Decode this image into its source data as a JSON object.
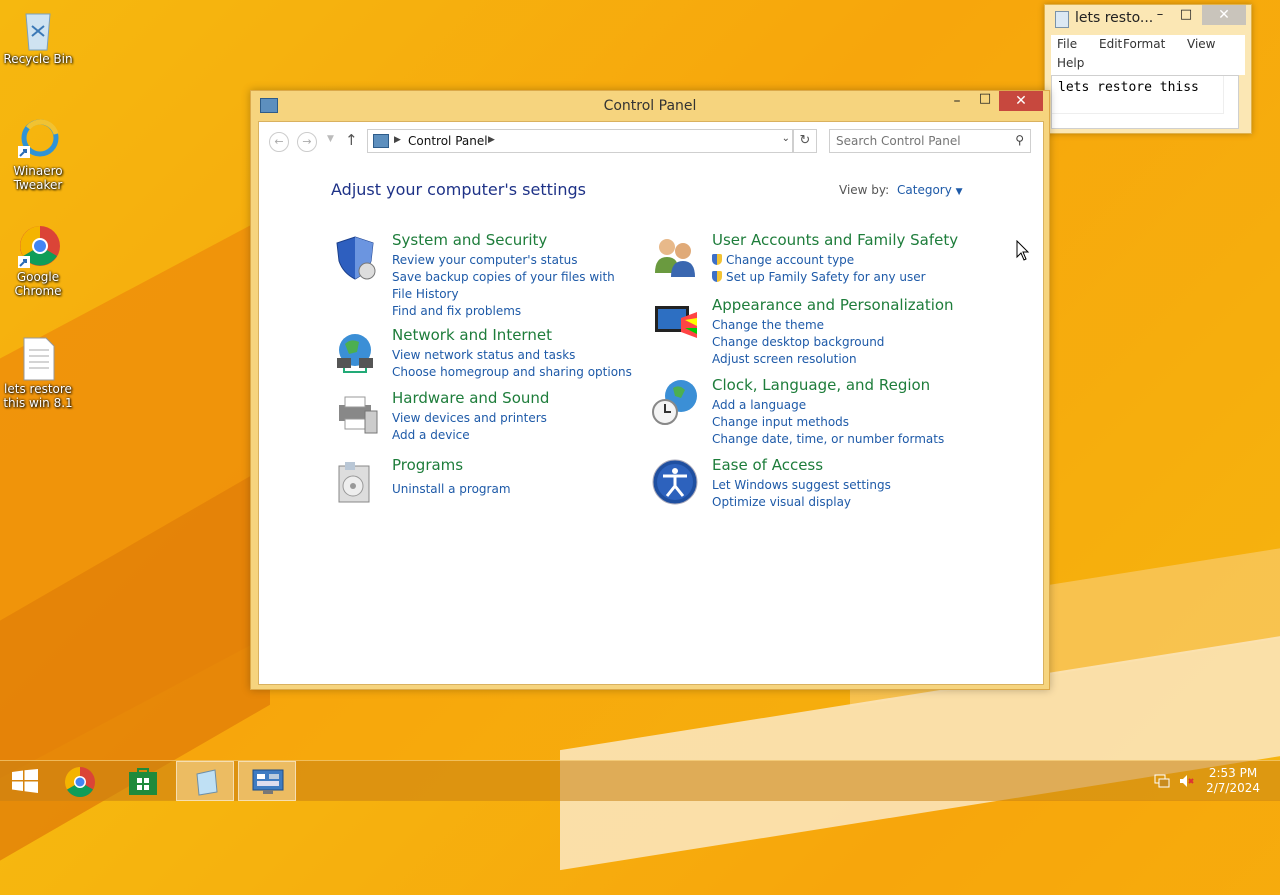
{
  "desktop": {
    "icons": [
      {
        "label": "Recycle Bin"
      },
      {
        "label": "Winaero Tweaker"
      },
      {
        "label": "Google Chrome"
      },
      {
        "label": "lets restore this win 8.1"
      }
    ]
  },
  "notepad": {
    "title": "lets resto...",
    "menu": [
      "File",
      "Edit",
      "Format",
      "View",
      "Help"
    ],
    "content": "lets restore thiss"
  },
  "control_panel": {
    "title": "Control Panel",
    "breadcrumb": "Control Panel",
    "search_placeholder": "Search Control Panel",
    "heading": "Adjust your computer's settings",
    "view_by_label": "View by:",
    "view_by_value": "Category",
    "categories": [
      {
        "title": "System and Security",
        "links": [
          "Review your computer's status",
          "Save backup copies of your files with File History",
          "Find and fix problems"
        ]
      },
      {
        "title": "Network and Internet",
        "links": [
          "View network status and tasks",
          "Choose homegroup and sharing options"
        ]
      },
      {
        "title": "Hardware and Sound",
        "links": [
          "View devices and printers",
          "Add a device"
        ]
      },
      {
        "title": "Programs",
        "links": [
          "Uninstall a program"
        ]
      },
      {
        "title": "User Accounts and Family Safety",
        "links": [
          "Change account type",
          "Set up Family Safety for any user"
        ]
      },
      {
        "title": "Appearance and Personalization",
        "links": [
          "Change the theme",
          "Change desktop background",
          "Adjust screen resolution"
        ]
      },
      {
        "title": "Clock, Language, and Region",
        "links": [
          "Add a language",
          "Change input methods",
          "Change date, time, or number formats"
        ]
      },
      {
        "title": "Ease of Access",
        "links": [
          "Let Windows suggest settings",
          "Optimize visual display"
        ]
      }
    ]
  },
  "taskbar": {
    "time": "2:53 PM",
    "date": "2/7/2024"
  }
}
